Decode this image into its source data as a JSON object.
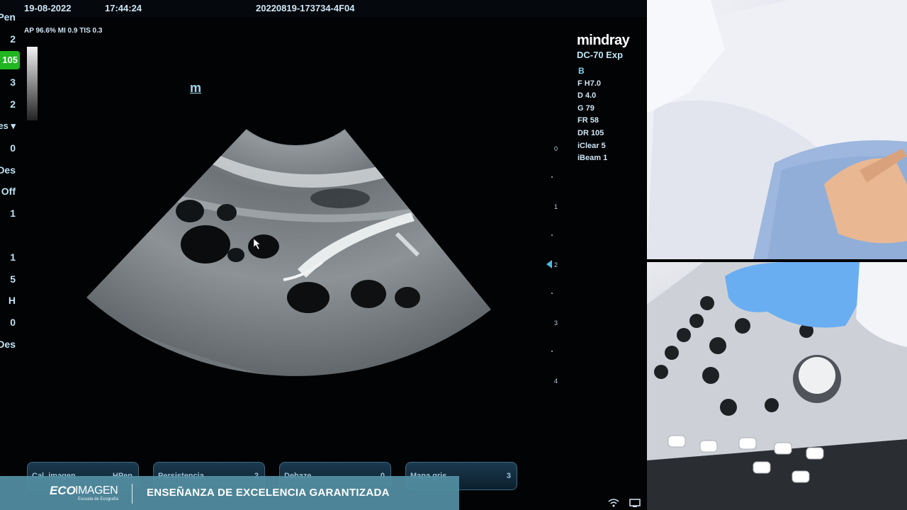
{
  "header": {
    "date": "19-08-2022",
    "time": "17:44:24",
    "exam_id": "20220819-173734-4F04"
  },
  "acoustic_output": "AP 96.6%  MI 0.9  TIS 0.3",
  "left_panel": {
    "items": [
      "Pen",
      "2",
      "105",
      "3",
      "2",
      "es ▾",
      "0",
      "Des",
      "Off",
      "1",
      "1",
      "5",
      "H",
      "0",
      "Des"
    ]
  },
  "body_marker": "m",
  "brand": {
    "name": "mindray",
    "model": "DC-70 Exp"
  },
  "imaging_mode": "B",
  "params": [
    "F H7.0",
    "D 4.0",
    "G 79",
    "FR 58",
    "DR 105",
    "iClear 5",
    "iBeam 1"
  ],
  "depth_scale": [
    "0",
    "1",
    "2",
    "3",
    "4"
  ],
  "softkeys": [
    {
      "label": "Cal. imagen",
      "value": "HPen"
    },
    {
      "label": "Persistencia",
      "value": "2"
    },
    {
      "label": "Dehaze",
      "value": "0"
    },
    {
      "label": "Mapa gris",
      "value": "3"
    }
  ],
  "banner": {
    "logo_eco": "ECO",
    "logo_imagen": "IMAGEN",
    "logo_sub": "Escuela de Ecografía",
    "text": "ENSEÑANZA DE EXCELENCIA GARANTIZADA"
  },
  "colors": {
    "active_param": "#21b521",
    "banner": "#538ea2",
    "screen_bg": "#020305"
  },
  "icons": [
    "wifi-icon",
    "monitor-icon",
    "arrow-cursor-icon"
  ]
}
